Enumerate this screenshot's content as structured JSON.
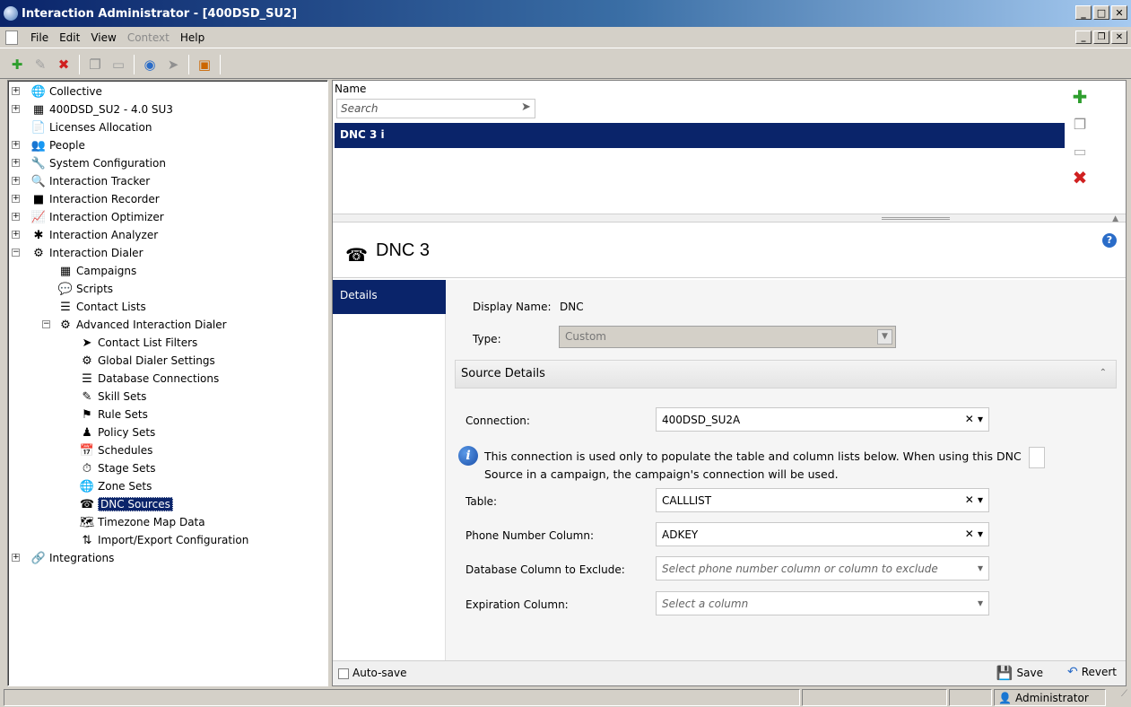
{
  "window": {
    "title": "Interaction Administrator - [400DSD_SU2]"
  },
  "menu": {
    "file": "File",
    "edit": "Edit",
    "view": "View",
    "context": "Context",
    "help": "Help"
  },
  "tree": [
    {
      "label": "Collective",
      "icon": "collective-icon",
      "glyph": "🌐",
      "exp": "+",
      "level": 0
    },
    {
      "label": "400DSD_SU2 - 4.0 SU3",
      "icon": "server-icon",
      "glyph": "▦",
      "exp": "+",
      "level": 0
    },
    {
      "label": "Licenses Allocation",
      "icon": "license-icon",
      "glyph": "📄",
      "exp": "",
      "level": 0
    },
    {
      "label": "People",
      "icon": "people-icon",
      "glyph": "👥",
      "exp": "+",
      "level": 0
    },
    {
      "label": "System Configuration",
      "icon": "wrench-icon",
      "glyph": "🔧",
      "exp": "+",
      "level": 0
    },
    {
      "label": "Interaction Tracker",
      "icon": "magnifier-icon",
      "glyph": "🔍",
      "exp": "+",
      "level": 0
    },
    {
      "label": "Interaction Recorder",
      "icon": "recorder-icon",
      "glyph": "■",
      "exp": "+",
      "level": 0
    },
    {
      "label": "Interaction Optimizer",
      "icon": "chart-icon",
      "glyph": "📈",
      "exp": "+",
      "level": 0
    },
    {
      "label": "Interaction Analyzer",
      "icon": "analyzer-icon",
      "glyph": "✱",
      "exp": "+",
      "level": 0
    },
    {
      "label": "Interaction Dialer",
      "icon": "dialer-icon",
      "glyph": "⚙",
      "exp": "−",
      "level": 0
    },
    {
      "label": "Campaigns",
      "icon": "grid-icon",
      "glyph": "▦",
      "exp": "",
      "level": 1
    },
    {
      "label": "Scripts",
      "icon": "speech-bubble-icon",
      "glyph": "💬",
      "exp": "",
      "level": 1
    },
    {
      "label": "Contact Lists",
      "icon": "list-icon",
      "glyph": "☰",
      "exp": "",
      "level": 1
    },
    {
      "label": "Advanced Interaction Dialer",
      "icon": "advanced-dialer-icon",
      "glyph": "⚙",
      "exp": "−",
      "level": 1
    },
    {
      "label": "Contact List Filters",
      "icon": "filter-icon",
      "glyph": "➤",
      "exp": "",
      "level": 2
    },
    {
      "label": "Global Dialer Settings",
      "icon": "settings-icon",
      "glyph": "⚙",
      "exp": "",
      "level": 2
    },
    {
      "label": "Database Connections",
      "icon": "database-icon",
      "glyph": "☰",
      "exp": "",
      "level": 2
    },
    {
      "label": "Skill Sets",
      "icon": "skill-icon",
      "glyph": "✎",
      "exp": "",
      "level": 2
    },
    {
      "label": "Rule Sets",
      "icon": "flag-icon",
      "glyph": "⚑",
      "exp": "",
      "level": 2
    },
    {
      "label": "Policy Sets",
      "icon": "policy-icon",
      "glyph": "♟",
      "exp": "",
      "level": 2
    },
    {
      "label": "Schedules",
      "icon": "calendar-icon",
      "glyph": "📅",
      "exp": "",
      "level": 2
    },
    {
      "label": "Stage Sets",
      "icon": "stopwatch-icon",
      "glyph": "⏱",
      "exp": "",
      "level": 2
    },
    {
      "label": "Zone Sets",
      "icon": "globe-icon",
      "glyph": "🌐",
      "exp": "",
      "level": 2
    },
    {
      "label": "DNC Sources",
      "icon": "dnc-icon",
      "glyph": "☎",
      "exp": "",
      "level": 2,
      "selected": true
    },
    {
      "label": "Timezone Map Data",
      "icon": "timezone-icon",
      "glyph": "🗺",
      "exp": "",
      "level": 2
    },
    {
      "label": "Import/Export Configuration",
      "icon": "import-export-icon",
      "glyph": "⇅",
      "exp": "",
      "level": 2
    },
    {
      "label": "Integrations",
      "icon": "integrations-icon",
      "glyph": "🔗",
      "exp": "+",
      "level": 0
    }
  ],
  "list": {
    "header": "Name",
    "search_placeholder": "Search",
    "rows": [
      "DNC 3 i"
    ]
  },
  "detail": {
    "title": "DNC 3",
    "nav": [
      "Details"
    ],
    "display_name_label": "Display Name:",
    "display_name_value": "DNC",
    "type_label": "Type:",
    "type_value": "Custom",
    "section_title": "Source Details",
    "connection_label": "Connection:",
    "connection_value": "400DSD_SU2A",
    "info_text": "This connection is used only to populate the table and column lists below. When using this DNC Source in a campaign, the campaign's connection will be used.",
    "table_label": "Table:",
    "table_value": "CALLLIST",
    "phone_label": "Phone Number Column:",
    "phone_value": "ADKEY",
    "exclude_label": "Database Column to Exclude:",
    "exclude_placeholder": "Select phone number column or column to exclude",
    "expiration_label": "Expiration Column:",
    "expiration_placeholder": "Select a column"
  },
  "bottom": {
    "autosave": "Auto-save",
    "save": "Save",
    "revert": "Revert"
  },
  "status": {
    "user": "Administrator"
  },
  "colors": {
    "selection": "#0a246a",
    "titlebar": "#0a246a",
    "add_green": "#2e9e2e",
    "delete_red": "#d02020"
  }
}
